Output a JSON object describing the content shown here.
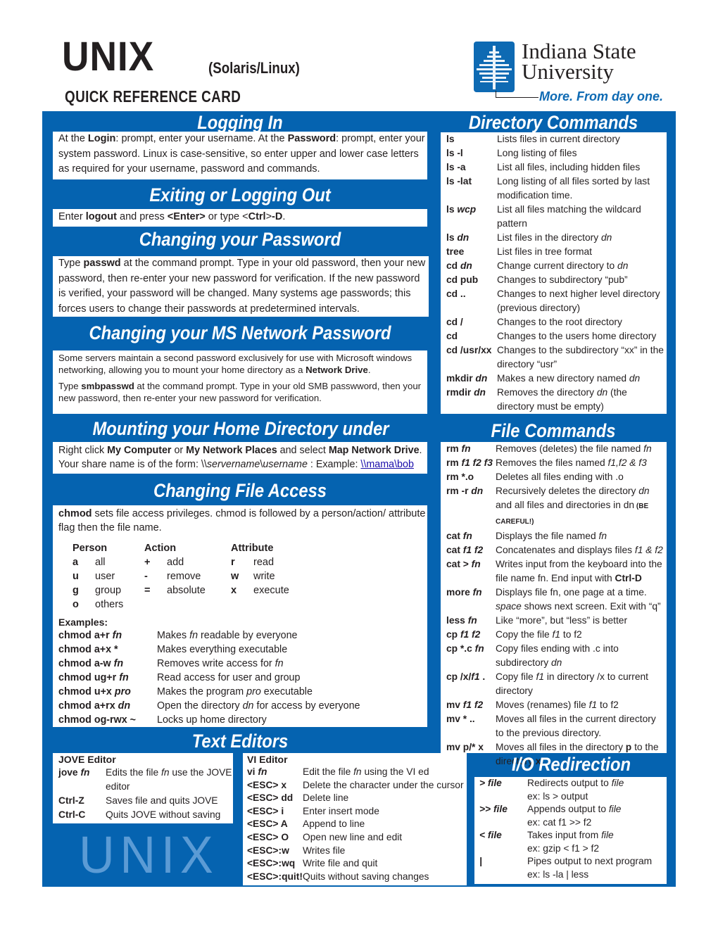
{
  "header": {
    "title": "UNIX",
    "subtitle": "(Solaris/Linux)",
    "card_label": "QUICK REFERENCE CARD",
    "logo": {
      "line1": "Indiana State",
      "line2": "University",
      "tagline": "More. From day one."
    }
  },
  "colors": {
    "brand_blue": "#0563b0",
    "watermark": "#5b9bd5",
    "link": "#1a0dab"
  },
  "logging_in": {
    "heading": "Logging In",
    "t1": "At the ",
    "b1": "Login",
    "t2": ": prompt, enter your username. At the ",
    "b2": "Password",
    "t3": ": prompt, enter your system password. Linux is case-sensitive, so enter upper and lower case letters as required for your username, password and commands."
  },
  "exiting": {
    "heading": "Exiting or Logging Out",
    "t1": "Enter ",
    "b1": "logout",
    "t2": " and press ",
    "b2": "<Enter>",
    "t3": " or type <",
    "b3": "Ctrl",
    "t4": ">",
    "b4": "-D",
    "t5": "."
  },
  "password": {
    "heading": "Changing your Password",
    "t1": "Type ",
    "b1": "passwd",
    "t2": " at the command prompt. Type in your old password, then your new password, then re-enter your new password for verification. If the new password is verified, your password will be changed. Many systems age passwords; this forces users to change their passwords at predetermined intervals."
  },
  "ms_password": {
    "heading": "Changing your MS Network Password",
    "p1_t1": "Some servers maintain a second password exclusively for use with Microsoft windows networking, allowing you to mount your home directory as a ",
    "p1_b1": "Network Drive",
    "p1_t2": ".",
    "p2_t1": "Type ",
    "p2_b1": "smbpasswd",
    "p2_t2": " at the command prompt.  Type in your old SMB passwword, then your new password, then re-enter your new password for verification."
  },
  "mounting": {
    "heading": "Mounting your Home Directory under Windows",
    "t1": "Right click ",
    "b1": "My Computer",
    "t2": " or ",
    "b2": "My Network Places",
    "t3": " and select ",
    "b3": "Map Network Drive",
    "t4": ".",
    "t5": "Your share name is of the form: \\\\",
    "i1": "servername",
    "t6": "\\",
    "i2": "username",
    "t7": " : Example: ",
    "link": "\\\\mama\\bob"
  },
  "file_access": {
    "heading": "Changing File Access",
    "intro_b": "chmod",
    "intro_t": " sets file access privileges. chmod is followed by a person/action/ attribute flag then the file name.",
    "columns": [
      "Person",
      "Action",
      "Attribute"
    ],
    "person": [
      [
        "a",
        "all"
      ],
      [
        "u",
        "user"
      ],
      [
        "g",
        "group"
      ],
      [
        "o",
        "others"
      ]
    ],
    "action": [
      [
        "+",
        "add"
      ],
      [
        "-",
        "remove"
      ],
      [
        "=",
        "absolute"
      ]
    ],
    "attribute": [
      [
        "r",
        "read"
      ],
      [
        "w",
        "write"
      ],
      [
        "x",
        "execute"
      ]
    ],
    "examples_label": "Examples:",
    "examples": [
      {
        "cmd": "chmod a+r ",
        "arg": "fn",
        "d1": "Makes ",
        "di": "fn",
        "d2": " readable by everyone"
      },
      {
        "cmd": "chmod a+x *",
        "arg": "",
        "d1": "Makes everything executable",
        "di": "",
        "d2": ""
      },
      {
        "cmd": "chmod a-w ",
        "arg": "fn",
        "d1": "Removes write access for ",
        "di": "fn",
        "d2": ""
      },
      {
        "cmd": "chmod ug+r ",
        "arg": "fn",
        "d1": "Read access for user and group",
        "di": "",
        "d2": ""
      },
      {
        "cmd": "chmod u+x ",
        "arg": "pro",
        "d1": "Makes the program ",
        "di": "pro",
        "d2": " executable"
      },
      {
        "cmd": "chmod a+rx ",
        "arg": "dn",
        "d1": "Open the directory ",
        "di": "dn",
        "d2": " for access by everyone"
      },
      {
        "cmd": "chmod og-rwx ~",
        "arg": "",
        "d1": "Locks up home directory",
        "di": "",
        "d2": ""
      }
    ]
  },
  "text_editors": {
    "heading": "Text Editors",
    "jove": {
      "title": "JOVE Editor",
      "rows": [
        {
          "cmd": "jove ",
          "arg": "fn",
          "d1": "Edits the file ",
          "di": "fn",
          "d2": " use the JOVE editor"
        },
        {
          "cmd": "Ctrl-Z",
          "arg": "",
          "d1": "Saves file and quits JOVE",
          "di": "",
          "d2": ""
        },
        {
          "cmd": "Ctrl-C",
          "arg": "",
          "d1": "Quits JOVE without saving",
          "di": "",
          "d2": ""
        }
      ]
    },
    "vi": {
      "title": "VI Editor",
      "rows": [
        {
          "cmd": "vi ",
          "arg": "fn",
          "d1": "Edit the file ",
          "di": "fn",
          "d2": " using the VI editor"
        },
        {
          "cmd": "<ESC> x",
          "arg": "",
          "d1": "Delete the character under the cursor",
          "di": "",
          "d2": ""
        },
        {
          "cmd": "<ESC> dd",
          "arg": "",
          "d1": "Delete line",
          "di": "",
          "d2": ""
        },
        {
          "cmd": "<ESC> i",
          "arg": "",
          "d1": "Enter insert mode",
          "di": "",
          "d2": ""
        },
        {
          "cmd": "<ESC> A",
          "arg": "",
          "d1": "Append to line",
          "di": "",
          "d2": ""
        },
        {
          "cmd": "<ESC> O",
          "arg": "",
          "d1": "Open new line and edit",
          "di": "",
          "d2": ""
        },
        {
          "cmd": "<ESC>:w",
          "arg": "",
          "d1": "Writes file",
          "di": "",
          "d2": ""
        },
        {
          "cmd": "<ESC>:wq",
          "arg": "",
          "d1": "Write file and quit",
          "di": "",
          "d2": ""
        },
        {
          "cmd": "<ESC>:quit!",
          "arg": "",
          "d1": "Quits without saving changes",
          "di": "",
          "d2": ""
        }
      ]
    },
    "watermark": "UNIX"
  },
  "directory_commands": {
    "heading": "Directory Commands",
    "rows": [
      {
        "cmd": "ls",
        "arg": "",
        "d1": "Lists files in current directory",
        "di": "",
        "d2": ""
      },
      {
        "cmd": "ls -l",
        "arg": "",
        "d1": "Long listing of files",
        "di": "",
        "d2": ""
      },
      {
        "cmd": "ls -a",
        "arg": "",
        "d1": "List all files, including hidden files",
        "di": "",
        "d2": ""
      },
      {
        "cmd": "ls -lat",
        "arg": "",
        "d1": "Long listing of all files sorted by last modification time.",
        "di": "",
        "d2": ""
      },
      {
        "cmd": "ls ",
        "arg": "wcp",
        "d1": "List all files matching the wildcard pattern",
        "di": "",
        "d2": ""
      },
      {
        "cmd": "ls ",
        "arg": "dn",
        "d1": "List files in the directory ",
        "di": "dn",
        "d2": ""
      },
      {
        "cmd": "tree",
        "arg": "",
        "d1": "List files in tree format",
        "di": "",
        "d2": ""
      },
      {
        "cmd": "cd ",
        "arg": "dn",
        "d1": "Change current directory to ",
        "di": "dn",
        "d2": ""
      },
      {
        "cmd": "cd pub",
        "arg": "",
        "d1": "Changes to subdirectory “pub”",
        "di": "",
        "d2": ""
      },
      {
        "cmd": "cd ..",
        "arg": "",
        "d1": "Changes to next higher level directory (previous directory)",
        "di": "",
        "d2": ""
      },
      {
        "cmd": "cd /",
        "arg": "",
        "d1": "Changes to the root directory",
        "di": "",
        "d2": ""
      },
      {
        "cmd": "cd",
        "arg": "",
        "d1": "Changes to the users home directory",
        "di": "",
        "d2": ""
      },
      {
        "cmd": "cd /usr/xx",
        "arg": "",
        "d1": "Changes to the subdirectory “xx” in the directory “usr”",
        "di": "",
        "d2": ""
      },
      {
        "cmd": "mkdir ",
        "arg": "dn",
        "d1": "Makes a new directory named ",
        "di": "dn",
        "d2": ""
      },
      {
        "cmd": "rmdir ",
        "arg": "dn",
        "d1": "Removes the directory ",
        "di": "dn",
        "d2": " (the directory must be empty)"
      }
    ]
  },
  "file_commands": {
    "heading": "File Commands",
    "rows": [
      {
        "cmd": "rm ",
        "arg": "fn",
        "d1": "Removes (deletes) the file named ",
        "di": "fn",
        "d2": ""
      },
      {
        "cmd": "rm ",
        "arg": "f1 f2 f3",
        "d1": "Removes the files named ",
        "di": "f1,f2 & f3",
        "d2": ""
      },
      {
        "cmd": "rm *.o",
        "arg": "",
        "d1": "Deletes all files ending with .o",
        "di": "",
        "d2": ""
      },
      {
        "cmd": "rm -r ",
        "arg": "dn",
        "d1": "Recursively deletes the directory ",
        "di": "dn",
        "d2": " and all files and directories in dn",
        "warn": "(BE CAREFUL!)"
      },
      {
        "cmd": "cat ",
        "arg": "fn",
        "d1": "Displays the file named ",
        "di": "fn",
        "d2": ""
      },
      {
        "cmd": "cat ",
        "arg": "f1 f2",
        "d1": "Concatenates and displays files ",
        "di": "f1 & f2",
        "d2": ""
      },
      {
        "cmd": "cat > ",
        "arg": "fn",
        "d1": "Writes input from the keyboard into the file name fn. End input with ",
        "di": "",
        "d2": "",
        "bold_tail": "Ctrl-D"
      },
      {
        "cmd": "more ",
        "arg": "fn",
        "d1": "Displays file fn, one page at a time. ",
        "di": "space",
        "d2": " shows next screen. Exit with “q”"
      },
      {
        "cmd": "less ",
        "arg": "fn",
        "d1": "Like “more”, but “less” is better",
        "di": "",
        "d2": ""
      },
      {
        "cmd": "cp ",
        "arg": "f1 f2",
        "d1": "Copy the file ",
        "di": "f1",
        "d2": " to f2"
      },
      {
        "cmd": "cp *.c ",
        "arg": "fn",
        "d1": "Copy files ending with .c into subdirectory ",
        "di": "dn",
        "d2": ""
      },
      {
        "cmd": "cp /x/",
        "arg": "f1",
        "d1": "Copy file ",
        "di": "f1",
        "d2": " in directory /x to current directory",
        "cmd_tail": " ."
      },
      {
        "cmd": "mv ",
        "arg": "f1 f2",
        "d1": "Moves (renames) file ",
        "di": "f1",
        "d2": " to f2"
      },
      {
        "cmd": "mv * ..",
        "arg": "",
        "d1": "Moves all files in the current directory to the previous directory.",
        "di": "",
        "d2": ""
      },
      {
        "cmd": "mv p/* x",
        "arg": "",
        "d1": "Moves all files in the directory ",
        "di": "",
        "d2": "",
        "bold_mid": "p",
        "d3": " to the directory ",
        "bold_end": "x",
        "d4": "."
      }
    ]
  },
  "io_redirection": {
    "heading": "I/O Redirection",
    "rows": [
      {
        "cmd": "> file",
        "d1": "Redirects output to ",
        "di": "file",
        "ex": "ex: ls > output"
      },
      {
        "cmd": ">> file",
        "d1": "Appends output to ",
        "di": "file",
        "ex": "ex: cat f1 >> f2"
      },
      {
        "cmd": "< file",
        "d1": "Takes input from ",
        "di": "file",
        "ex": "ex: gzip < f1 > f2"
      },
      {
        "cmd": "|",
        "d1": "Pipes output to next program",
        "di": "",
        "ex": "ex: ls -la | less"
      }
    ]
  }
}
